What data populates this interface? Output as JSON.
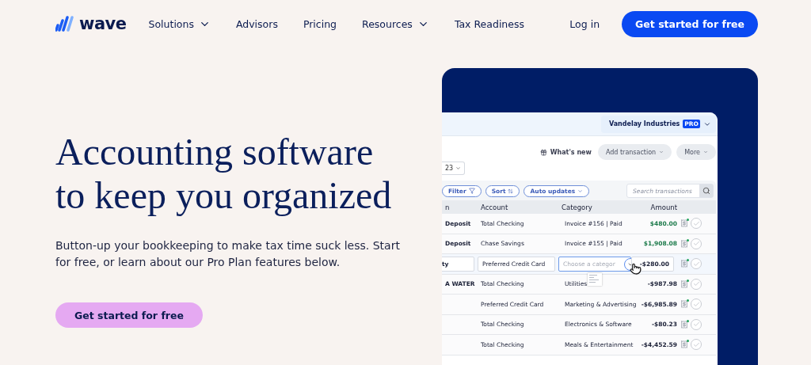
{
  "nav": {
    "logo": "wave",
    "items": [
      {
        "label": "Solutions",
        "has_menu": true
      },
      {
        "label": "Advisors",
        "has_menu": false
      },
      {
        "label": "Pricing",
        "has_menu": false
      },
      {
        "label": "Resources",
        "has_menu": true
      },
      {
        "label": "Tax Readiness",
        "has_menu": false
      }
    ],
    "login": "Log in",
    "cta": "Get started for free"
  },
  "hero": {
    "title": "Accounting software to keep you organized",
    "subtitle": "Button-up your bookkeeping to make tax time suck less. Start for free, or learn about our Pro Plan features below.",
    "cta": "Get started for free"
  },
  "app": {
    "company": "Vandelay Industries",
    "badge": "PRO",
    "whats_new": "What's new",
    "add_transaction": "Add transaction",
    "more": "More",
    "date": "23",
    "filters": [
      {
        "label": "Filter",
        "kind": "filter"
      },
      {
        "label": "Sort",
        "kind": "sort"
      },
      {
        "label": "Auto updates",
        "kind": "menu"
      }
    ],
    "search": {
      "placeholder": "Search transactions"
    },
    "columns": [
      "n",
      "Account",
      "Category",
      "Amount"
    ],
    "rows": [
      {
        "kind": "normal",
        "column_1": "Deposit",
        "account": "Total Checking",
        "category": "Invoice #156 | Paid",
        "amount": "$480.00",
        "color": "#1c7a4a"
      },
      {
        "kind": "normal",
        "column_1": "Deposit",
        "account": "Chase Savings",
        "category": "Invoice #155 | Paid",
        "amount": "$1,908.08",
        "color": "#1c7a4a"
      },
      {
        "kind": "edit",
        "column_1": "ty",
        "account": "Preferred Credit Card",
        "category": "Choose a categor",
        "amount": "-$280.00",
        "color": "#1a1f36"
      },
      {
        "kind": "normal",
        "column_1": "A WATER",
        "account": "Total Checking",
        "category": "Utilities",
        "amount": "-$987.98",
        "color": "#1a1f36"
      },
      {
        "kind": "normal",
        "account": "Preferred Credit Card",
        "category": "Marketing & Advertising",
        "amount": "-$6,985.89",
        "color": "#1a1f36"
      },
      {
        "kind": "normal",
        "account": "Total Checking",
        "category": "Electronics & Software",
        "amount": "-$80.23",
        "color": "#1a1f36"
      },
      {
        "kind": "normal",
        "account": "Total Checking",
        "category": "Meals & Entertainment",
        "amount": "-$4,452.59",
        "color": "#1a1f36"
      }
    ]
  }
}
